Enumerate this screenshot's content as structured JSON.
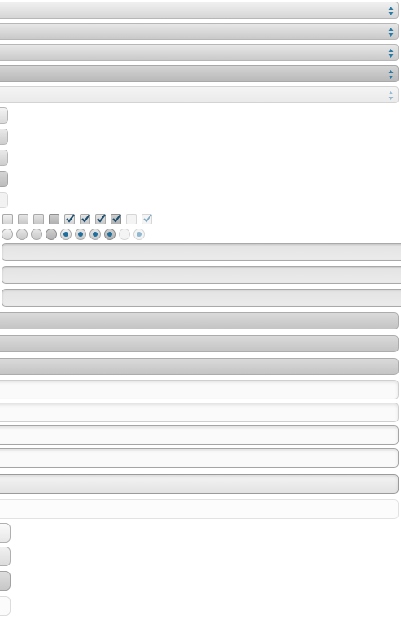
{
  "selects": [
    {
      "state": "normal"
    },
    {
      "state": "hover"
    },
    {
      "state": "focused"
    },
    {
      "state": "active"
    },
    {
      "state": "disabled"
    }
  ],
  "sliders": [
    "normal",
    "hover",
    "focused",
    "active",
    "disabled"
  ],
  "checkboxes": [
    {
      "state": "normal",
      "checked": false
    },
    {
      "state": "hover",
      "checked": false
    },
    {
      "state": "focused",
      "checked": false
    },
    {
      "state": "active",
      "checked": false
    },
    {
      "state": "normal",
      "checked": true
    },
    {
      "state": "hover",
      "checked": true
    },
    {
      "state": "focused",
      "checked": true
    },
    {
      "state": "active",
      "checked": true
    },
    {
      "state": "disabled",
      "checked": false
    },
    {
      "state": "disabled",
      "checked": true
    }
  ],
  "radios": [
    {
      "state": "normal",
      "selected": false
    },
    {
      "state": "hover",
      "selected": false
    },
    {
      "state": "focused",
      "selected": false
    },
    {
      "state": "active",
      "selected": false
    },
    {
      "state": "normal",
      "selected": true
    },
    {
      "state": "hover",
      "selected": true
    },
    {
      "state": "focused",
      "selected": true
    },
    {
      "state": "active",
      "selected": true
    },
    {
      "state": "disabled",
      "selected": false
    },
    {
      "state": "disabled",
      "selected": true
    }
  ],
  "progress_tracks": [
    "normal",
    "hover",
    "focused"
  ],
  "raised_bars": [
    "normal",
    "hover",
    "active"
  ],
  "text_fields": [
    "normal",
    "hover",
    "focused",
    "active",
    "pressed",
    "disabled"
  ],
  "buttons": [
    "normal",
    "hover",
    "active",
    "disabled"
  ],
  "colors": {
    "accent": "#1f6e9c",
    "border": "#a9a9a9",
    "background": "#ffffff"
  },
  "icons": {
    "select_arrows": "up-down-arrows-icon",
    "checkmark": "checkmark-icon",
    "radio_dot": "radio-dot-icon"
  }
}
